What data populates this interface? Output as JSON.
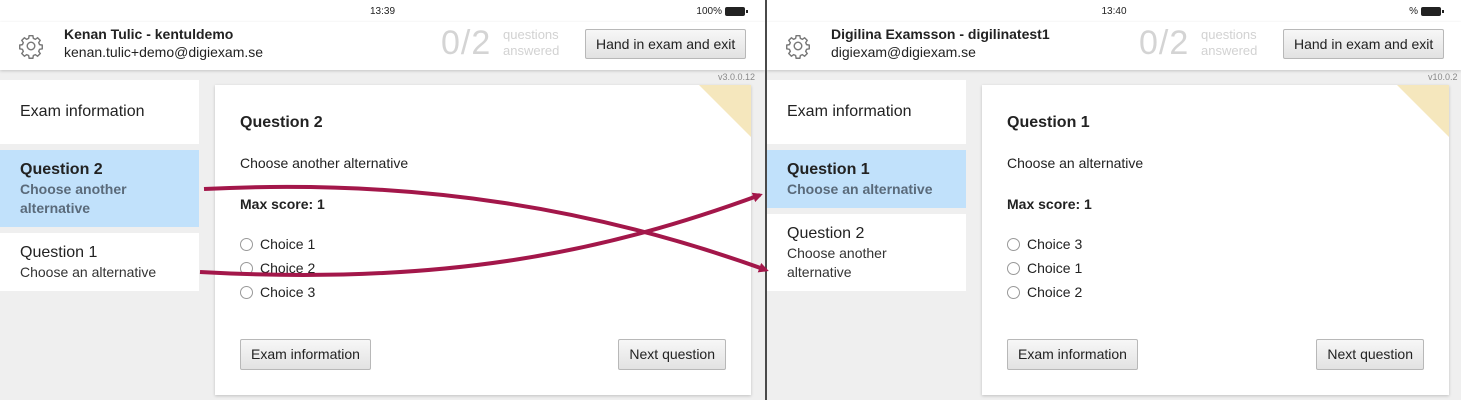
{
  "left": {
    "status": {
      "time": "13:39",
      "battery": "100%"
    },
    "header": {
      "user_name": "Kenan Tulic - kentuldemo",
      "user_email": "kenan.tulic+demo@digiexam.se",
      "progress": "0/2",
      "progress_label_1": "questions",
      "progress_label_2": "answered",
      "hand_in_label": "Hand in exam and exit"
    },
    "version": "v3.0.0.12",
    "sidebar": {
      "info_label": "Exam information",
      "items": [
        {
          "title": "Question 2",
          "subtitle_1": "Choose another",
          "subtitle_2": "alternative",
          "active": true
        },
        {
          "title": "Question 1",
          "subtitle_1": "Choose an alternative",
          "subtitle_2": "",
          "active": false
        }
      ]
    },
    "question": {
      "heading": "Question 2",
      "prompt": "Choose another alternative",
      "score": "Max score: 1",
      "choices": [
        "Choice 1",
        "Choice 2",
        "Choice 3"
      ],
      "exam_info_label": "Exam information",
      "next_label": "Next question"
    }
  },
  "right": {
    "status": {
      "time": "13:40",
      "battery": "%"
    },
    "header": {
      "user_name": "Digilina Examsson - digilinatest1",
      "user_email": "digiexam@digiexam.se",
      "progress": "0/2",
      "progress_label_1": "questions",
      "progress_label_2": "answered",
      "hand_in_label": "Hand in exam and exit"
    },
    "version": "v10.0.2",
    "sidebar": {
      "info_label": "Exam information",
      "items": [
        {
          "title": "Question 1",
          "subtitle_1": "Choose an alternative",
          "subtitle_2": "",
          "active": true
        },
        {
          "title": "Question 2",
          "subtitle_1": "Choose another",
          "subtitle_2": "alternative",
          "active": false
        }
      ]
    },
    "question": {
      "heading": "Question 1",
      "prompt": "Choose an alternative",
      "score": "Max score: 1",
      "choices": [
        "Choice 3",
        "Choice 1",
        "Choice 2"
      ],
      "exam_info_label": "Exam information",
      "next_label": "Next question"
    }
  },
  "colors": {
    "active_item": "#c1e1fb",
    "arrow": "#a3174a",
    "corner_flag": "#f5e7bd"
  }
}
